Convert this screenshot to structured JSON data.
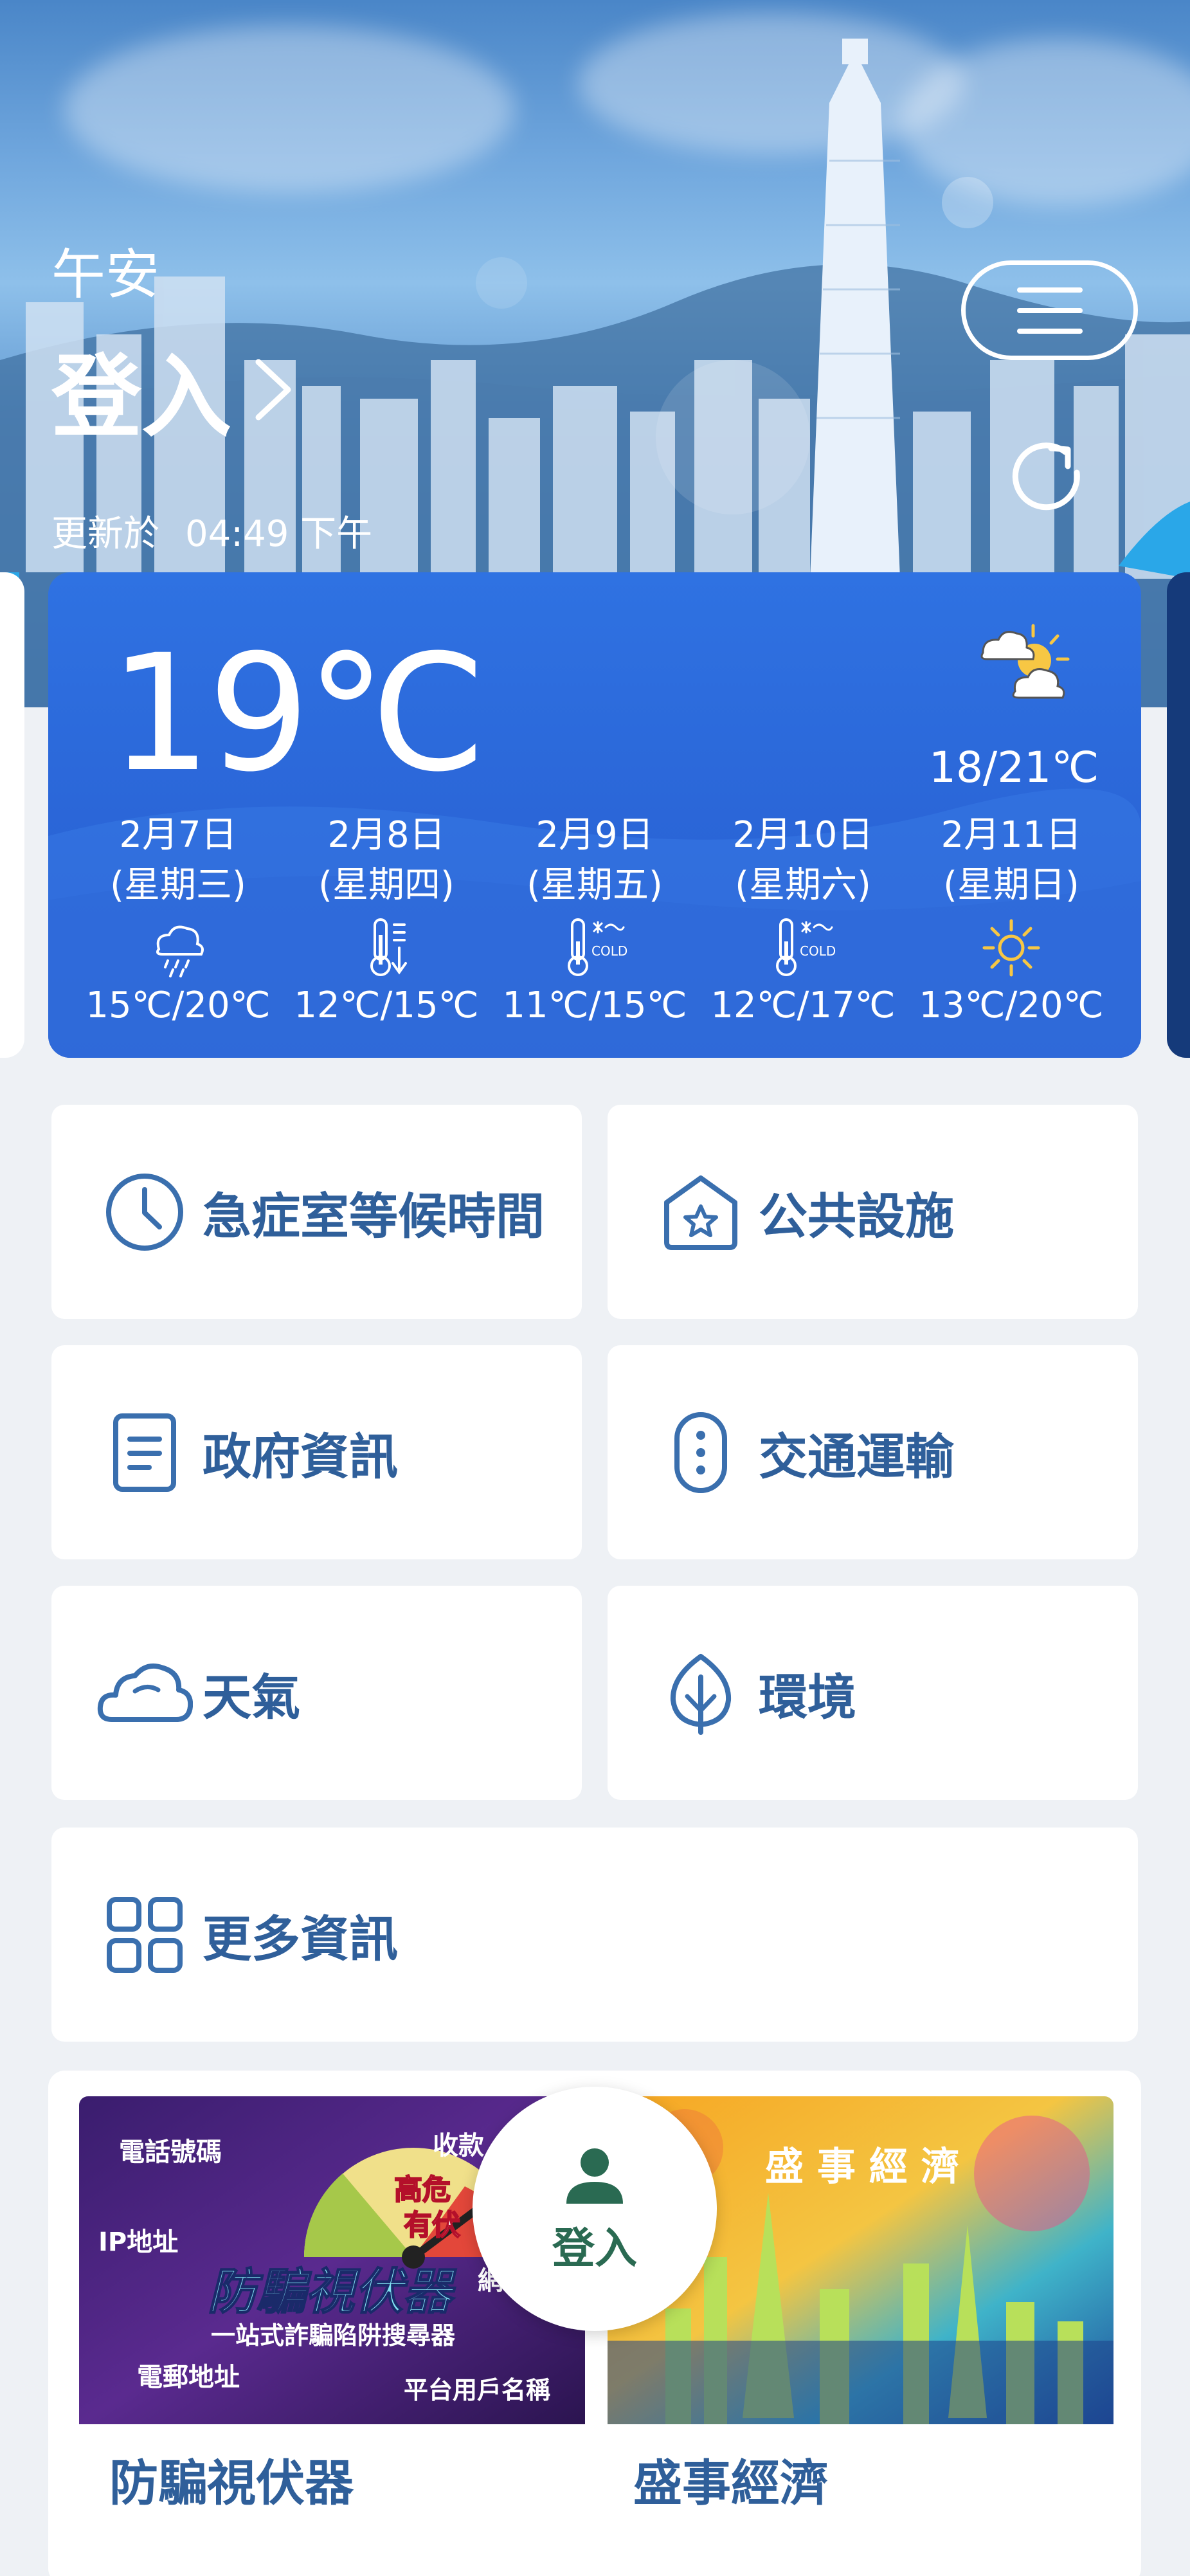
{
  "header": {
    "greeting": "午安",
    "login": "登入",
    "updated_label": "更新於",
    "updated_time": "04:49 下午"
  },
  "weather": {
    "current_temp": "19℃",
    "current_icon": "sun-behind-clouds-icon",
    "today_range": "18/21℃",
    "forecast": [
      {
        "date": "2月7日",
        "weekday": "(星期三)",
        "icon": "rain-cloud-icon",
        "range": "15℃/20℃"
      },
      {
        "date": "2月8日",
        "weekday": "(星期四)",
        "icon": "thermometer-falling-icon",
        "range": "12℃/15℃"
      },
      {
        "date": "2月9日",
        "weekday": "(星期五)",
        "icon": "cold-thermometer-icon",
        "range": "11℃/15℃"
      },
      {
        "date": "2月10日",
        "weekday": "(星期六)",
        "icon": "cold-thermometer-icon",
        "range": "12℃/17℃"
      },
      {
        "date": "2月11日",
        "weekday": "(星期日)",
        "icon": "sunny-icon",
        "range": "13℃/20℃"
      }
    ],
    "cold_label": "COLD"
  },
  "tiles": {
    "ae_wait": "急症室等候時間",
    "facilities": "公共設施",
    "gov_info": "政府資訊",
    "transport": "交通運輸",
    "weather": "天氣",
    "environment": "環境",
    "more": "更多資訊"
  },
  "banners": {
    "scameter_caption": "防騙視伏器",
    "scameter_title": "防騙視伏器",
    "scameter_subtitle": "一站式詐騙陷阱搜尋器",
    "scameter_labels": [
      "電話號碼",
      "IP地址",
      "電郵地址",
      "收款",
      "網",
      "平台用戶名稱"
    ],
    "scameter_alert": [
      "高危",
      "有伏"
    ],
    "event_caption": "盛事經濟",
    "event_title": "盛 事 經 濟"
  },
  "fab": {
    "label": "登入"
  },
  "colors": {
    "primary_text": "#2f5f9a",
    "weather_card": "#2f72e2",
    "fab_green": "#2a6a52",
    "background": "#eef1f5"
  }
}
